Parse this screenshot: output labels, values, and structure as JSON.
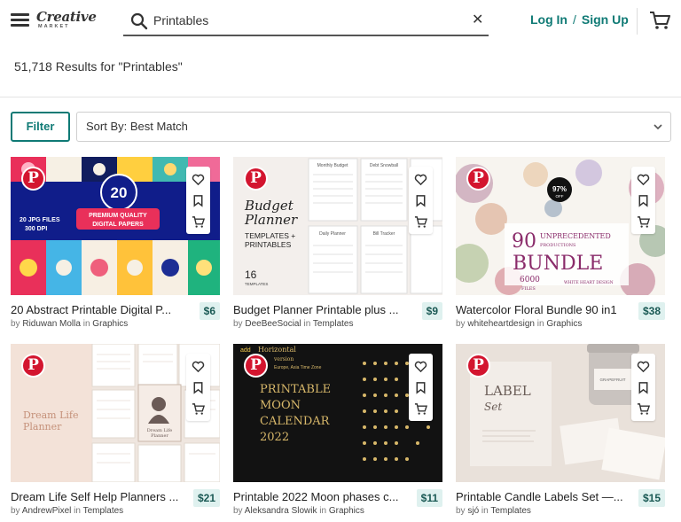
{
  "header": {
    "logo_line1": "Creative",
    "logo_line2": "MARKET",
    "search_value": "Printables",
    "login": "Log In",
    "separator": "/",
    "signup": "Sign Up"
  },
  "results_text": "51,718 Results for \"Printables\"",
  "filter_label": "Filter",
  "sort_label": "Sort By: Best Match",
  "products": [
    {
      "title": "20 Abstract Printable Digital P...",
      "price": "$6",
      "author": "Riduwan Molla",
      "in": "in",
      "category": "Graphics"
    },
    {
      "title": "Budget Planner Printable plus ...",
      "price": "$9",
      "author": "DeeBeeSocial",
      "in": "in",
      "category": "Templates"
    },
    {
      "title": "Watercolor Floral Bundle 90 in1",
      "price": "$38",
      "author": "whiteheartdesign",
      "in": "in",
      "category": "Graphics"
    },
    {
      "title": "Dream Life Self Help Planners ...",
      "price": "$21",
      "author": "AndrewPixel",
      "in": "in",
      "category": "Templates"
    },
    {
      "title": "Printable 2022 Moon phases c...",
      "price": "$11",
      "author": "Aleksandra Slowik",
      "in": "in",
      "category": "Graphics"
    },
    {
      "title": "Printable Candle Labels Set —...",
      "price": "$15",
      "author": "sjó",
      "in": "in",
      "category": "Templates"
    }
  ],
  "thumb_text": {
    "t1_badge": "20",
    "t1_line1": "PREMIUM QUALITY",
    "t1_line2": "DIGITAL PAPERS",
    "t1_files1": "20 JPG FILES",
    "t1_files2": "300 DPI",
    "t2_h1": "Budget",
    "t2_h2": "Planner",
    "t2_sub1": "TEMPLATES +",
    "t2_sub2": "PRINTABLES",
    "t2_num": "16",
    "t2_small": "TEMPLATES",
    "t2_p1": "Monthly Budget",
    "t2_p2": "Debt Snowball",
    "t2_p3": "Daily Planner",
    "t2_p4": "Bill Tracker",
    "t3_pct": "97%",
    "t3_off": "OFF",
    "t3_n": "90",
    "t3_line1": "UNPRECEDENTED",
    "t3_line2": "PRODUCTIONS",
    "t3_bundle": "BUNDLE",
    "t3_num": "6000",
    "t3_files": "FILES",
    "t3_credit": "WHITE HEART DESIGN",
    "t4_title1": "Dream Life",
    "t4_title2": "Planner",
    "t4_book1": "Dream Life",
    "t4_book2": "Planner",
    "t5_add": "add",
    "t5_h": "Horizontal",
    "t5_v": "version",
    "t5_tz": "Europe, Asia Time Zone",
    "t5_l1": "PRINTABLE",
    "t5_l2": "MOON",
    "t5_l3": "CALENDAR",
    "t5_year": "2022",
    "t6_brand": "LABEL",
    "t6_set": "Set",
    "t6_jar": "GRAPEFRUIT"
  },
  "colors": {
    "accent": "#0f7a75",
    "price_bg": "#dff1ef",
    "pinterest": "#d3152f"
  },
  "icons": [
    "menu-icon",
    "search-icon",
    "close-icon",
    "cart-icon",
    "chevron-down-icon",
    "pinterest-icon",
    "heart-icon",
    "bookmark-icon",
    "add-to-cart-icon"
  ]
}
